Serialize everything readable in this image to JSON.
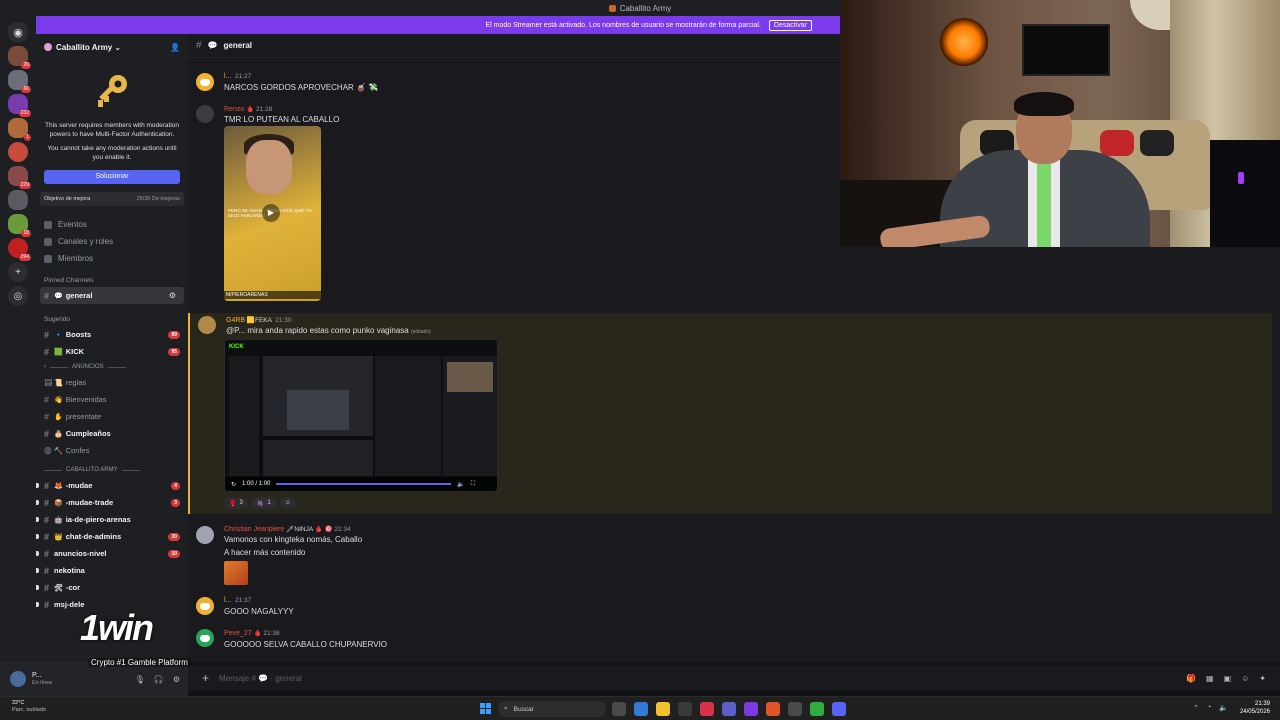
{
  "window": {
    "title": "Caballito Army"
  },
  "banner": {
    "text": "El modo Streamer está activado. Los nombres de usuario se mostrarán de forma parcial.",
    "button": "Desactivar",
    "accent": "#7c3aed"
  },
  "rail": {
    "badges": [
      "26",
      "66",
      "232",
      "1",
      "229",
      "18",
      "294"
    ]
  },
  "sidebar": {
    "server_name": "Caballito Army",
    "mfa": {
      "line1": "This server requires members with moderation powers to have Multi-Factor Authentication.",
      "line2": "You cannot take any moderation actions until you enable it.",
      "button": "Solucionar"
    },
    "goal": {
      "label": "Objetivo de mejora",
      "progress": "25/36 De mejoras"
    },
    "nav": [
      "Eventos",
      "Canales y roles",
      "Miembros"
    ],
    "pinned_label": "Pinned Channels",
    "pinned_channel": "general",
    "suggested_label": "Sugerido",
    "suggested": [
      {
        "name": "Boosts",
        "count": "89"
      },
      {
        "name": "KICK",
        "count": "95"
      }
    ],
    "cat1": "ANUNCIOS",
    "channels1": [
      "reglas",
      "Bienvenidas",
      "presentate",
      "Cumpleaños",
      "Confes"
    ],
    "cat2": "CABALLITO ARMY",
    "channels2": [
      {
        "name": "-mudae",
        "count": "4"
      },
      {
        "name": "-mudae-trade",
        "count": "3"
      },
      {
        "name": "ia-de-piero-arenas",
        "count": ""
      },
      {
        "name": "chat-de-admins",
        "count": "30"
      },
      {
        "name": "anuncios-nivel",
        "count": "10"
      },
      {
        "name": "nekotina",
        "count": ""
      },
      {
        "name": "-cor",
        "count": ""
      },
      {
        "name": "msj-dele",
        "count": ""
      }
    ]
  },
  "user": {
    "name": "P...",
    "status": "En línea"
  },
  "overlay": {
    "logo": "1win",
    "tagline": "Crypto #1 Gamble Platform"
  },
  "channel": {
    "name": "general"
  },
  "messages": [
    {
      "author": "l...",
      "time": "21:27",
      "text": "NARCOS GORDOS APROVECHAR"
    },
    {
      "author": "Renzo",
      "time": "21:28",
      "text": "TMR LO PUTEAN AL CABALLO",
      "video_caption": "PERO SE AMAN... PIERO DICE QUE YO SIGO HABLANDO",
      "video_handle": "M/PIEROARENAS"
    },
    {
      "author": "G4RB",
      "tag": "FEKA",
      "time": "21:30",
      "text": "@P... mira anda rapido estas como punko vaginasa",
      "edited": "(editado)",
      "video_time": "1:00 / 1:00",
      "reactions": [
        "3",
        "1"
      ]
    },
    {
      "author": "Christian Jeanpiere",
      "tag": "NINJA",
      "time": "21:34",
      "text": "Vamonos con kingteka nomás, Caballo",
      "text2": "A hacer más contenido"
    },
    {
      "author": "l...",
      "time": "21:37",
      "text": "GOOO NAGALYYY"
    },
    {
      "author": "Peve_27",
      "time": "21:38",
      "text": "GOOOOO SELVA CABALLO CHUPANERVIO"
    }
  ],
  "composer": {
    "placeholder": "Mensaje #",
    "channel": "general"
  },
  "taskbar": {
    "temp": "22°C",
    "weather": "Parc. nublado",
    "search": "Buscar",
    "time": "21:39",
    "date": "24/05/2026"
  }
}
